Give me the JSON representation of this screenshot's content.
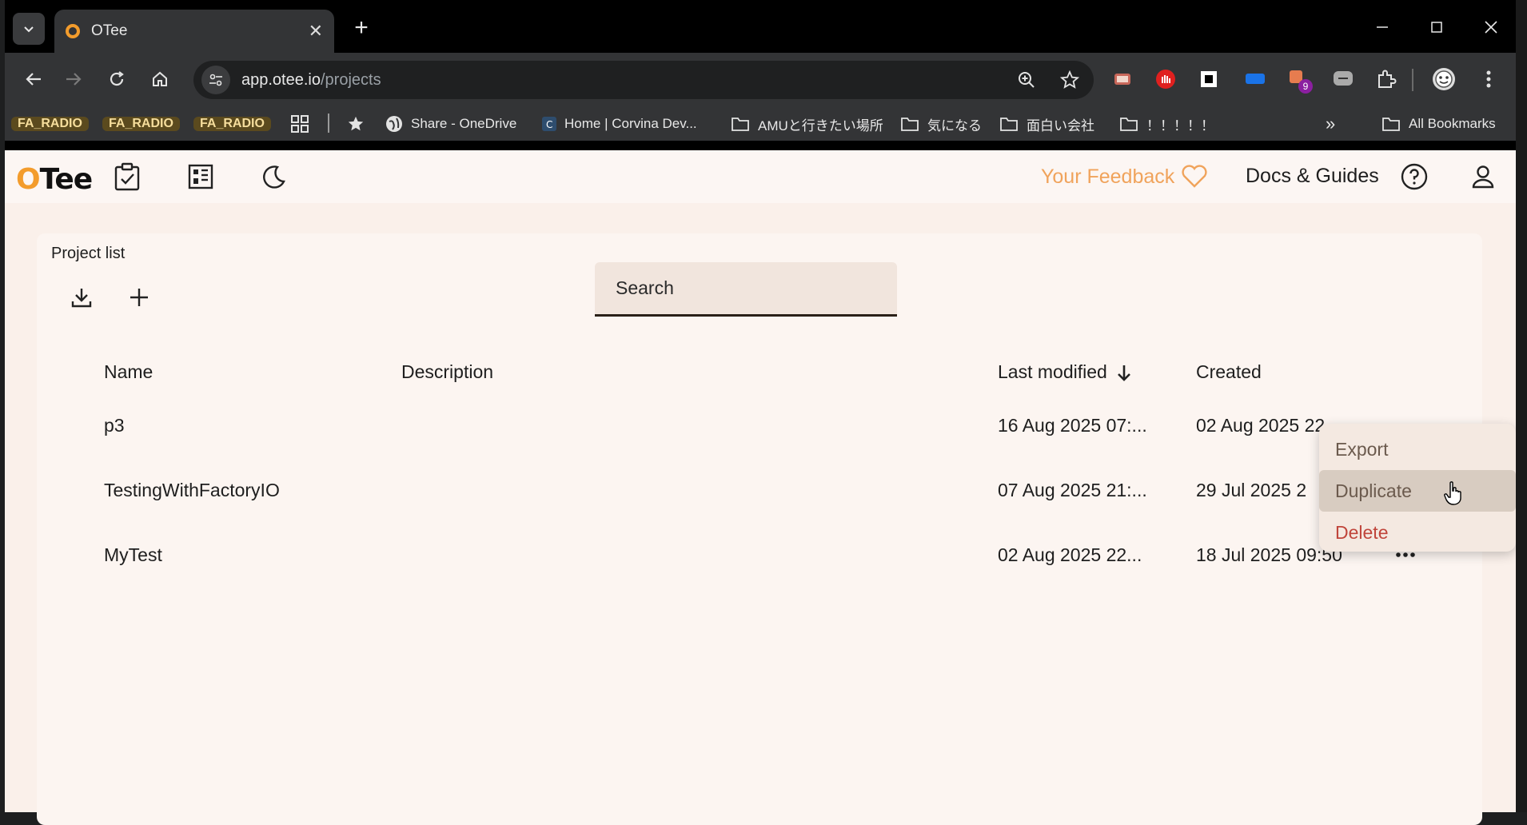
{
  "browser": {
    "tab_title": "OTee",
    "url_host": "app.otee.io",
    "url_path": "/projects",
    "extension_badge": "9"
  },
  "bookmarks": {
    "chips": [
      "FA_RADIO",
      "FA_RADIO",
      "FA_RADIO"
    ],
    "items": [
      "Share - OneDrive",
      "Home | Corvina Dev...",
      "AMUと行きたい場所",
      "気になる",
      "面白い会社",
      "！！！！！"
    ],
    "overflow": "»",
    "all_bookmarks": "All Bookmarks"
  },
  "header": {
    "logo_c": "O",
    "logo_rest": "Tee",
    "feedback": "Your Feedback",
    "docs": "Docs & Guides"
  },
  "projects": {
    "title": "Project list",
    "search_placeholder": "Search",
    "columns": {
      "name": "Name",
      "description": "Description",
      "last_modified": "Last modified",
      "created": "Created"
    },
    "rows": [
      {
        "name": "p3",
        "description": "",
        "last_modified": "16 Aug 2025 07:...",
        "created": "02 Aug 2025 22"
      },
      {
        "name": "TestingWithFactoryIO",
        "description": "",
        "last_modified": "07 Aug 2025 21:...",
        "created": "29 Jul 2025 2"
      },
      {
        "name": "MyTest",
        "description": "",
        "last_modified": "02 Aug 2025 22...",
        "created": "18 Jul 2025 09:50"
      }
    ]
  },
  "context_menu": {
    "export": "Export",
    "duplicate": "Duplicate",
    "delete": "Delete"
  },
  "colors": {
    "accent": "#f39c2c",
    "feedback": "#f0a35b",
    "danger": "#c0453b",
    "app_bg": "#faf0ea"
  }
}
